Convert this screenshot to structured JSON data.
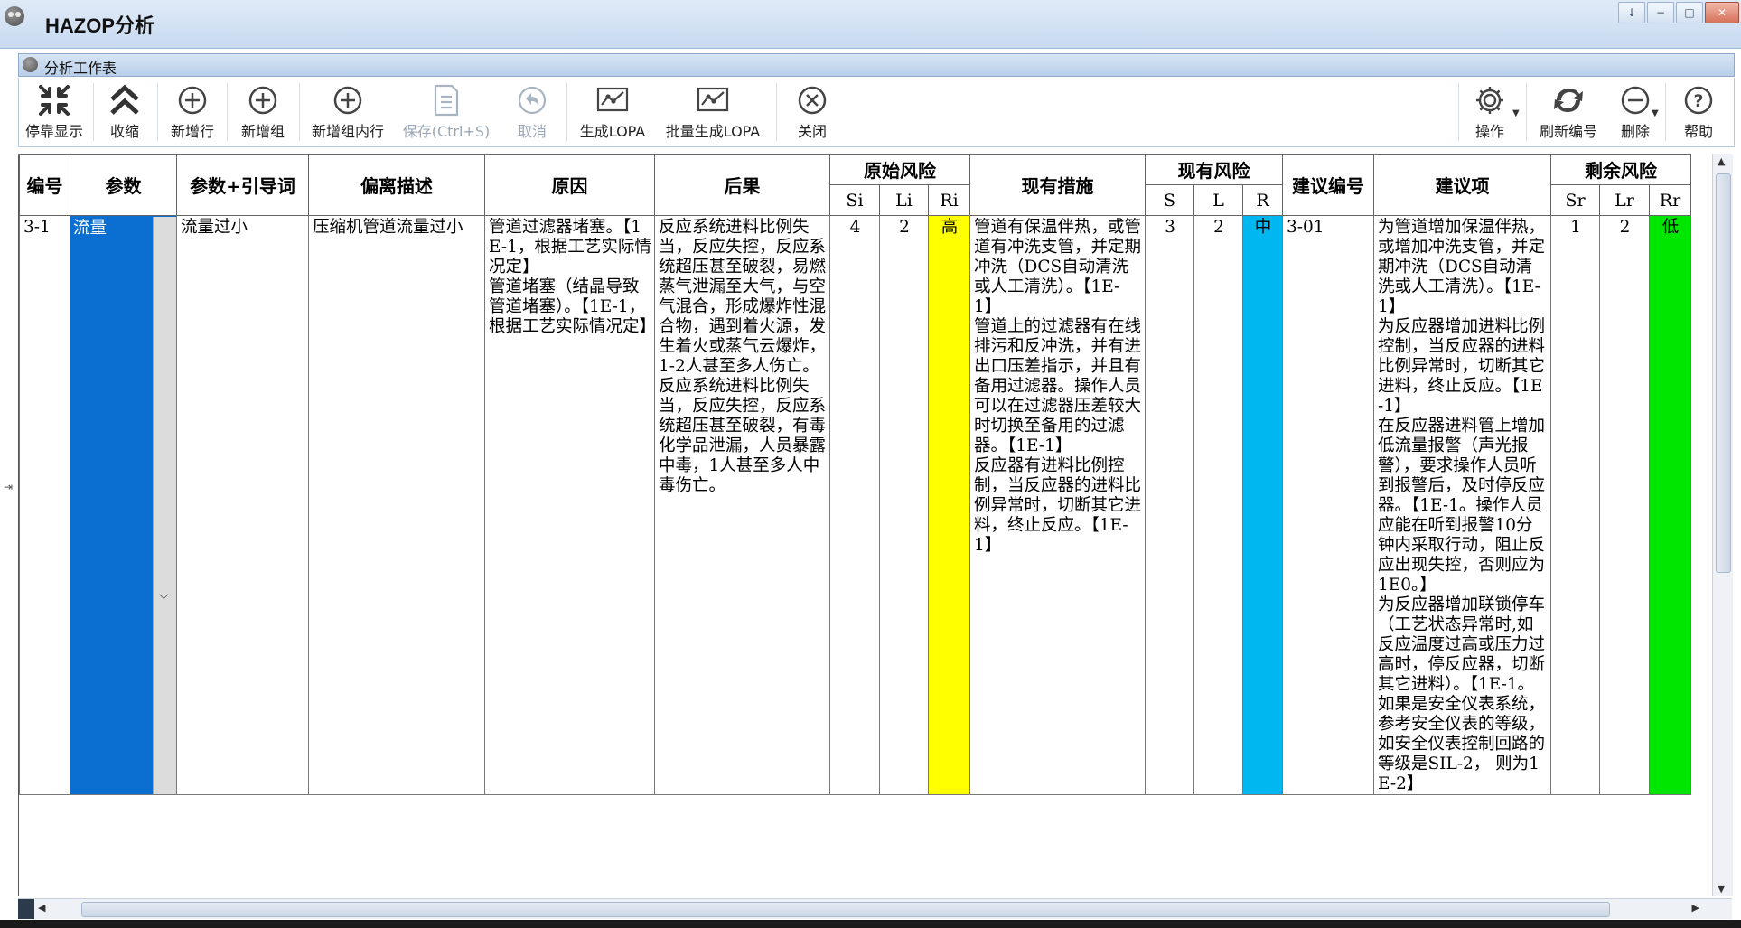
{
  "window": {
    "title": "HAZOP分析",
    "controls": [
      "pin",
      "minimize",
      "restore",
      "close"
    ]
  },
  "panel": {
    "title": "分析工作表"
  },
  "toolbar": {
    "dock": "停靠显示",
    "collapse": "收缩",
    "add_row": "新增行",
    "add_group": "新增组",
    "add_in_group": "新增组内行",
    "save": "保存(Ctrl+S)",
    "cancel": "取消",
    "gen_lopa": "生成LOPA",
    "batch_lopa": "批量生成LOPA",
    "close": "关闭",
    "operate": "操作",
    "renumber": "刷新编号",
    "delete": "删除",
    "help": "帮助"
  },
  "columns": {
    "id": "编号",
    "param": "参数",
    "param_guide": "参数+引导词",
    "deviation": "偏离描述",
    "cause": "原因",
    "consequence": "后果",
    "orig_risk": "原始风险",
    "si": "Si",
    "li": "Li",
    "ri": "Ri",
    "existing": "现有措施",
    "cur_risk": "现有风险",
    "s": "S",
    "l": "L",
    "r": "R",
    "rec_no": "建议编号",
    "recommend": "建议项",
    "res_risk": "剩余风险",
    "sr": "Sr",
    "lr": "Lr",
    "rr": "Rr"
  },
  "rows": [
    {
      "id": "3-1",
      "param": "流量",
      "param_guide": "流量过小",
      "deviation": "压缩机管道流量过小",
      "cause": "管道过滤器堵塞。【1E-1，根据工艺实际情况定】\n管道堵塞（结晶导致管道堵塞）。【1E-1，根据工艺实际情况定】",
      "consequence": "反应系统进料比例失当，反应失控，反应系统超压甚至破裂，易燃蒸气泄漏至大气，与空气混合，形成爆炸性混合物，遇到着火源，发生着火或蒸气云爆炸，1-2人甚至多人伤亡。\n反应系统进料比例失当，反应失控，反应系统超压甚至破裂，有毒化学品泄漏，人员暴露中毒，1人甚至多人中毒伤亡。",
      "si": "4",
      "li": "2",
      "ri": "高",
      "existing": "管道有保温伴热，或管道有冲洗支管，并定期冲洗（DCS自动清洗或人工清洗）。【1E-1】\n管道上的过滤器有在线排污和反冲洗，并有进出口压差指示，并且有备用过滤器。操作人员可以在过滤器压差较大时切换至备用的过滤器。【1E-1】\n反应器有进料比例控制，当反应器的进料比例异常时，切断其它进料，终止反应。【1E-1】",
      "s": "3",
      "l": "2",
      "r": "中",
      "rec_no": "3-01",
      "recommend": "为管道增加保温伴热，或增加冲洗支管，并定期冲洗（DCS自动清洗或人工清洗）。【1E-1】\n为反应器增加进料比例控制，当反应器的进料比例异常时，切断其它进料，终止反应。【1E-1】\n在反应器进料管上增加低流量报警（声光报警），要求操作人员听到报警后，及时停反应器。【1E-1。操作人员应能在听到报警10分钟内采取行动，阻止反应出现失控，否则应为1E0。】\n为反应器增加联锁停车（工艺状态异常时,如反应温度过高或压力过高时，停反应器，切断其它进料）。【1E-1。如果是安全仪表系统，参考安全仪表的等级，如安全仪表控制回路的等级是SIL-2， 则为1E-2】",
      "sr": "1",
      "lr": "2",
      "rr": "低"
    }
  ],
  "colors": {
    "high": "#ffff00",
    "medium": "#00b7f0",
    "low": "#00e600",
    "selected": "#0b6fd2"
  }
}
